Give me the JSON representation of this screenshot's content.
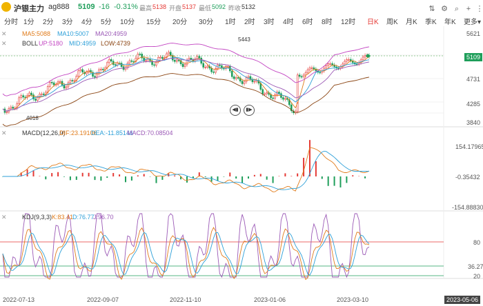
{
  "header": {
    "title": "沪银主力",
    "code": "ag888",
    "price": "5109",
    "change": "-16",
    "change_pct": "-0.31%",
    "high_label": "最高",
    "high": "5138",
    "open_label": "开盘",
    "open": "5137",
    "low_label": "最低",
    "low": "5092",
    "prev_label": "昨收",
    "prev": "5132"
  },
  "tabs": [
    "分时",
    "1分",
    "2分",
    "3分",
    "4分",
    "5分",
    "10分",
    "15分",
    "20分",
    "30分",
    "1时",
    "2时",
    "3时",
    "4时",
    "6时",
    "8时",
    "12时",
    "日K",
    "周K",
    "月K",
    "季K",
    "年K",
    "更多▾"
  ],
  "active_tab": "日K",
  "main_panel": {
    "ma_label": "MA5:5088",
    "ma10_label": "MA10:5007",
    "ma20_label": "MA20:4959",
    "boll_name": "BOLL",
    "boll_up": "UP:5180",
    "boll_mid": "MID:4959",
    "boll_low": "LOW:4739",
    "high_mark": "5443",
    "low_mark": "4018",
    "y_ticks": [
      "5621",
      "5109",
      "4731",
      "4285",
      "3840"
    ]
  },
  "macd_panel": {
    "name": "MACD(12,26,9)",
    "dif": "DIF:23.19106",
    "dea": "DEA:-11.85146",
    "macd": "MACD:70.08504",
    "y_ticks": [
      "154.17965",
      "-0.35432",
      "-154.88830"
    ]
  },
  "kdj_panel": {
    "name": "KDJ(9,3,3)",
    "k": "K:83.41",
    "d": "D:76.77",
    "j": "J:96.70",
    "y_ticks": [
      "80",
      "36.27",
      "20"
    ]
  },
  "x_axis": [
    "2022-07-13",
    "2022-09-07",
    "2022-11-10",
    "2023-01-06",
    "2023-03-10",
    "2023-05-06"
  ],
  "colors": {
    "up": "#e53935",
    "down": "#1e9e5a",
    "ma5": "#e07b1a",
    "ma10": "#2c9fd8",
    "ma20": "#9b59b6",
    "boll_up": "#c244c2",
    "boll_low": "#8b4513"
  },
  "icons": [
    "swap-icon",
    "settings-icon",
    "search-icon",
    "plus-icon",
    "more-icon"
  ]
}
